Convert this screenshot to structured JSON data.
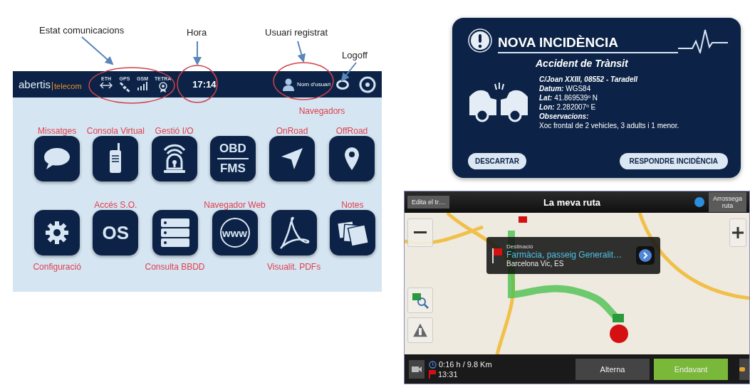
{
  "annotations": [
    {
      "label": "Estat comunicacions"
    },
    {
      "label": "Hora"
    },
    {
      "label": "Usuari registrat"
    },
    {
      "label": "Logoff"
    }
  ],
  "dashboard": {
    "logo": {
      "name": "abertis",
      "sub": "telecom"
    },
    "comms": [
      {
        "label": "ETH",
        "kind": "eth"
      },
      {
        "label": "GPS",
        "kind": "satellite"
      },
      {
        "label": "GSM",
        "kind": "signal"
      },
      {
        "label": "TETRA",
        "kind": "badge"
      }
    ],
    "time": "17:14",
    "user": "Nom d'usuari",
    "rows": [
      {
        "items": [
          {
            "kind": "chat",
            "label_above": "Missatges"
          },
          {
            "kind": "radio",
            "label_above": "Consola Virtual"
          },
          {
            "kind": "alarm",
            "label_above": "Gestió I/O"
          },
          {
            "kind": "text",
            "icon_lines": [
              "OBD",
              "FMS"
            ]
          },
          {
            "kind": "group",
            "label": "Navegadors",
            "items": [
              {
                "kind": "navigate",
                "label_above": "OnRoad"
              },
              {
                "kind": "pin",
                "label_above": "OffRoad"
              }
            ]
          }
        ]
      },
      {
        "items": [
          {
            "kind": "gear",
            "label_below": "Configuració"
          },
          {
            "kind": "text",
            "label_above": "Accés S.O.",
            "icon_lines": [
              "OS"
            ]
          },
          {
            "kind": "database",
            "label_below": "Consulta BBDD"
          },
          {
            "kind": "globe",
            "label_above": "Navegador Web",
            "icon_lines": [
              "www"
            ]
          },
          {
            "kind": "pdf",
            "label_below": "Visualit. PDFs"
          },
          {
            "kind": "notes",
            "label_above": "Notes"
          }
        ]
      }
    ]
  },
  "incident": {
    "title": "NOVA INCIDÈNCIA",
    "subtitle": "Accident de Trànsit",
    "details": [
      {
        "label": "C/Joan XXIII, 08552 - Taradell"
      },
      {
        "label": "Datum:",
        "value": "WGS84"
      },
      {
        "label": "Lat:",
        "value": "41.869539º N"
      },
      {
        "label": "Lon:",
        "value": "2.282007º E"
      },
      {
        "label": "Observacions:"
      },
      {
        "value": "Xoc frontal de 2 vehicles, 3 adults i 1 menor."
      }
    ],
    "buttons": [
      "DESCARTAR",
      "RESPONDRE INCIDÈNCIA"
    ]
  },
  "navigator": {
    "edit_button": "Edita el tr…",
    "title": "La meva ruta",
    "drag_button": [
      "Arrossega",
      "ruta"
    ],
    "popup": {
      "caption": "Destinació",
      "name": "Farmàcia, passeig Generalit…",
      "place": "Barcelona Vic, ES"
    },
    "trip": "0:16 h / 9.8 Km",
    "arrival": "13:31",
    "actions": [
      {
        "label": "Alterna",
        "selected": false
      },
      {
        "label": "Endavant",
        "selected": true
      }
    ]
  }
}
